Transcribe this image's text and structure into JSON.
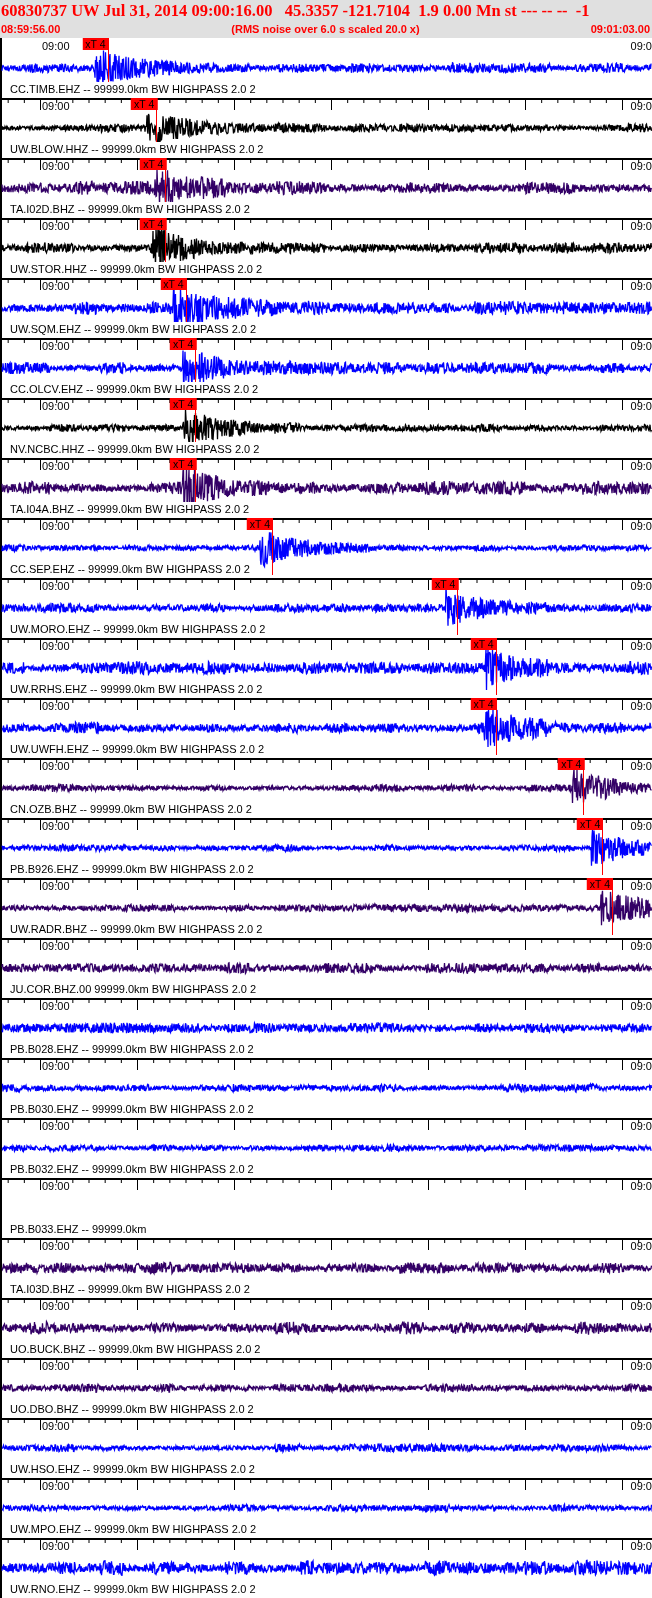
{
  "header": {
    "title": "60830737 UW Jul 31, 2014 09:00:16.00   45.3357 -121.7104  1.9 0.00 Mn st --- -- --  -1",
    "start_time": "08:59:56.00",
    "note": "(RMS noise over 6.0 s scaled 20.0 x)",
    "end_time": "09:01:03.00"
  },
  "traces": [
    {
      "label": "CC.TIMB.EHZ -- 99999.0km BW HIGHPASS 2.0 2",
      "start_label": "09:00",
      "end_label": "09:0",
      "color": "#0000ff",
      "pick": {
        "label": "xT 4"
      }
    },
    {
      "label": "UW.BLOW.HHZ -- 99999.0km BW HIGHPASS 2.0 2",
      "start_label": "09:00",
      "end_label": "09:0",
      "color": "#000000",
      "pick": {
        "label": "xT 4"
      }
    },
    {
      "label": "TA.I02D.BHZ -- 99999.0km BW HIGHPASS 2.0 2",
      "start_label": "09:00",
      "end_label": "09:0",
      "color": "#330066",
      "pick": {
        "label": "xT 4"
      }
    },
    {
      "label": "UW.STOR.HHZ -- 99999.0km BW HIGHPASS 2.0 2",
      "start_label": "09:00",
      "end_label": "09:0",
      "color": "#000000",
      "pick": {
        "label": "xT 4"
      }
    },
    {
      "label": "UW.SQM.EHZ -- 99999.0km BW HIGHPASS 2.0 2",
      "start_label": "09:00",
      "end_label": "09:0",
      "color": "#0000ff",
      "pick": {
        "label": "xT 4"
      }
    },
    {
      "label": "CC.OLCV.EHZ -- 99999.0km BW HIGHPASS 2.0 2",
      "start_label": "09:00",
      "end_label": "09:0",
      "color": "#0000ff",
      "pick": {
        "label": "xT 4"
      }
    },
    {
      "label": "NV.NCBC.HHZ -- 99999.0km BW HIGHPASS 2.0 2",
      "start_label": "09:00",
      "end_label": "09:0",
      "color": "#000000",
      "pick": {
        "label": "xT 4"
      }
    },
    {
      "label": "TA.I04A.BHZ -- 99999.0km BW HIGHPASS 2.0 2",
      "start_label": "09:00",
      "end_label": "09:0",
      "color": "#330066",
      "pick": {
        "label": "xT 4"
      }
    },
    {
      "label": "CC.SEP.EHZ -- 99999.0km BW HIGHPASS 2.0 2",
      "start_label": "09:00",
      "end_label": "09:0",
      "color": "#0000ff",
      "pick": {
        "label": "xT 4"
      }
    },
    {
      "label": "UW.MORO.EHZ -- 99999.0km BW HIGHPASS 2.0 2",
      "start_label": "09:00",
      "end_label": "09:0",
      "color": "#0000ff",
      "pick": {
        "label": "xT 4"
      }
    },
    {
      "label": "UW.RRHS.EHZ -- 99999.0km BW HIGHPASS 2.0 2",
      "start_label": "09:00",
      "end_label": "09:0",
      "color": "#0000ff",
      "pick": {
        "label": "xT 4"
      }
    },
    {
      "label": "UW.UWFH.EHZ -- 99999.0km BW HIGHPASS 2.0 2",
      "start_label": "09:00",
      "end_label": "09:0",
      "color": "#0000ff",
      "pick": {
        "label": "xT 4"
      }
    },
    {
      "label": "CN.OZB.BHZ -- 99999.0km BW HIGHPASS 2.0 2",
      "start_label": "09:00",
      "end_label": "09:0",
      "color": "#330066",
      "pick": {
        "label": "xT 4"
      }
    },
    {
      "label": "PB.B926.EHZ -- 99999.0km BW HIGHPASS 2.0 2",
      "start_label": "09:00",
      "end_label": "09:0",
      "color": "#0000ff",
      "pick": {
        "label": "xT 4"
      }
    },
    {
      "label": "UW.RADR.BHZ -- 99999.0km BW HIGHPASS 2.0 2",
      "start_label": "09:00",
      "end_label": "09:0",
      "color": "#330066",
      "pick": {
        "label": "xT 4"
      }
    },
    {
      "label": "JU.COR.BHZ.00 99999.0km BW HIGHPASS 2.0 2",
      "start_label": "09:00",
      "end_label": "09:0",
      "color": "#330066"
    },
    {
      "label": "PB.B028.EHZ -- 99999.0km BW HIGHPASS 2.0 2",
      "start_label": "09:00",
      "end_label": "09:0",
      "color": "#0000ff"
    },
    {
      "label": "PB.B030.EHZ -- 99999.0km BW HIGHPASS 2.0 2",
      "start_label": "09:00",
      "end_label": "09:0",
      "color": "#0000ff"
    },
    {
      "label": "PB.B032.EHZ -- 99999.0km BW HIGHPASS 2.0 2",
      "start_label": "09:00",
      "end_label": "09:0",
      "color": "#0000ff"
    },
    {
      "label": "PB.B033.EHZ -- 99999.0km",
      "start_label": "09:00",
      "end_label": "09:0"
    },
    {
      "label": "TA.I03D.BHZ -- 99999.0km BW HIGHPASS 2.0 2",
      "start_label": "09:00",
      "end_label": "09:0",
      "color": "#330066"
    },
    {
      "label": "UO.BUCK.BHZ -- 99999.0km BW HIGHPASS 2.0 2",
      "start_label": "09:00",
      "end_label": "09:0",
      "color": "#330066"
    },
    {
      "label": "UO.DBO.BHZ -- 99999.0km BW HIGHPASS 2.0 2",
      "start_label": "09:00",
      "end_label": "09:0",
      "color": "#330066"
    },
    {
      "label": "UW.HSO.EHZ -- 99999.0km BW HIGHPASS 2.0 2",
      "start_label": "09:00",
      "end_label": "09:0",
      "color": "#0000ff"
    },
    {
      "label": "UW.MPO.EHZ -- 99999.0km BW HIGHPASS 2.0 2",
      "start_label": "09:00",
      "end_label": "09:0",
      "color": "#0000ff"
    },
    {
      "label": "UW.RNO.EHZ -- 99999.0km BW HIGHPASS 2.0 2",
      "start_label": "09:00",
      "end_label": "09:0",
      "color": "#0000ff"
    }
  ]
}
